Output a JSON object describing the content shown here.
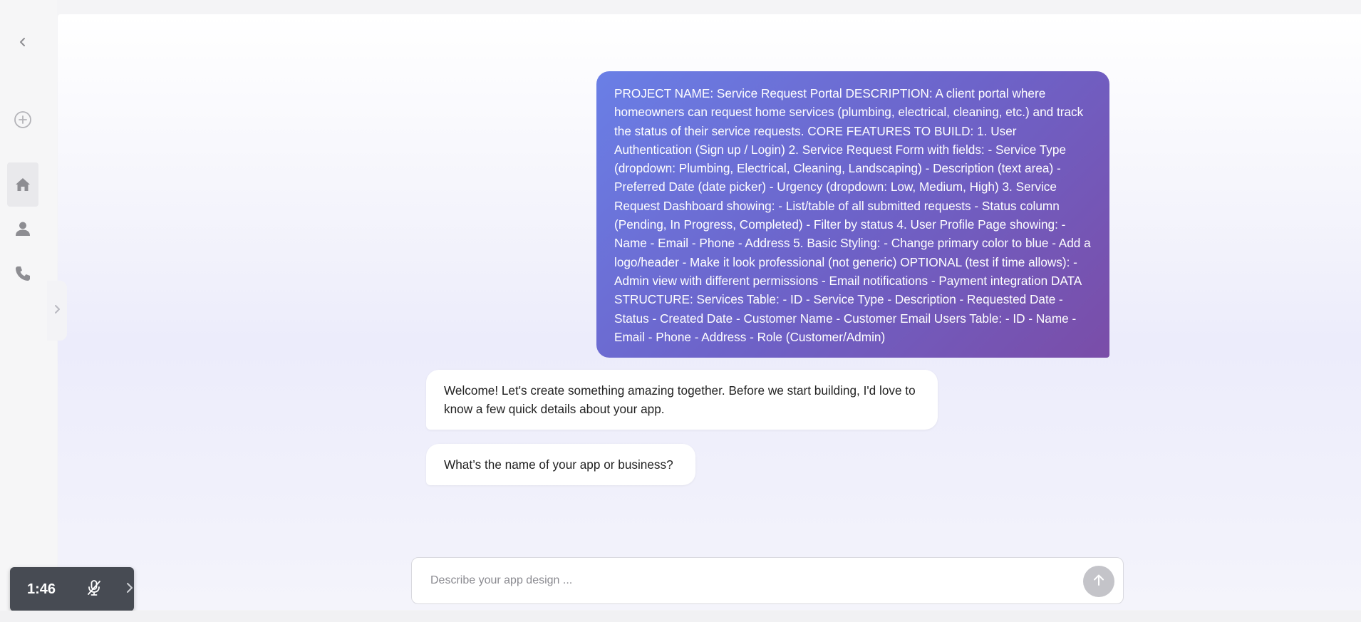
{
  "sidebar": {
    "items": [
      {
        "name": "back",
        "icon": "chevron-left-icon"
      },
      {
        "name": "new",
        "icon": "plus-circle-icon"
      },
      {
        "name": "home",
        "icon": "home-icon",
        "active": true
      },
      {
        "name": "profile",
        "icon": "user-icon"
      },
      {
        "name": "contact",
        "icon": "phone-icon"
      }
    ],
    "expand_icon": "chevron-right-icon"
  },
  "chat": {
    "user_message": "PROJECT NAME: Service Request Portal DESCRIPTION: A client portal where homeowners can request home services (plumbing, electrical, cleaning, etc.) and track the status of their service requests. CORE FEATURES TO BUILD: 1. User Authentication (Sign up / Login) 2. Service Request Form with fields: - Service Type (dropdown: Plumbing, Electrical, Cleaning, Landscaping) - Description (text area) - Preferred Date (date picker) - Urgency (dropdown: Low, Medium, High) 3. Service Request Dashboard showing: - List/table of all submitted requests - Status column (Pending, In Progress, Completed) - Filter by status 4. User Profile Page showing: - Name - Email - Phone - Address 5. Basic Styling: - Change primary color to blue - Add a logo/header - Make it look professional (not generic) OPTIONAL (test if time allows): - Admin view with different permissions - Email notifications - Payment integration DATA STRUCTURE: Services Table: - ID - Service Type - Description - Requested Date - Status - Created Date - Customer Name - Customer Email Users Table: - ID - Name - Email - Phone - Address - Role (Customer/Admin)",
    "bot_messages": [
      "Welcome! Let's create something amazing together. Before we start building, I'd love to know a few quick details about your app.",
      "What’s the name of your app or business?"
    ]
  },
  "composer": {
    "placeholder": "Describe your app design ...",
    "value": "",
    "send_icon": "arrow-up-icon"
  },
  "timer": {
    "time": "1:46",
    "mic_icon": "mic-off-icon",
    "expand_icon": "chevron-right-icon"
  },
  "colors": {
    "user_bubble_start": "#6a7fe6",
    "user_bubble_end": "#7a4da8",
    "bot_bubble": "#ffffff",
    "timer_bg": "#474b53",
    "send_button": "#c4c4c9"
  }
}
